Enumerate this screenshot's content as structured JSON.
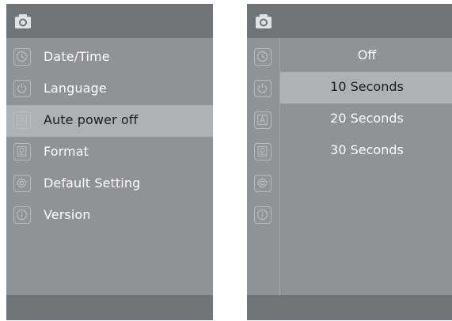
{
  "left_screen": {
    "camera_icon": "camera-icon",
    "menu": [
      {
        "label": "Date/Time",
        "icon": "clock-icon"
      },
      {
        "label": "Language",
        "icon": "power-icon"
      },
      {
        "label": "Aute power off",
        "icon": "letter-a-icon",
        "selected": true
      },
      {
        "label": "Format",
        "icon": "sd-card-icon"
      },
      {
        "label": "Default Setting",
        "icon": "gear-icon"
      },
      {
        "label": "Version",
        "icon": "info-icon"
      }
    ]
  },
  "right_screen": {
    "camera_icon": "camera-icon",
    "side_icons": [
      "clock-icon",
      "power-icon",
      "letter-a-icon",
      "sd-card-icon",
      "gear-icon",
      "info-icon"
    ],
    "options": [
      {
        "label": "Off"
      },
      {
        "label": "10 Seconds",
        "selected": true
      },
      {
        "label": "20 Seconds"
      },
      {
        "label": "30 Seconds"
      }
    ]
  },
  "colors": {
    "screen_bg": "#8d9396",
    "bar_bg": "#6f7477",
    "highlight_bg": "#adb2b4",
    "text": "#ffffff",
    "selected_text": "#1c1c1c"
  }
}
